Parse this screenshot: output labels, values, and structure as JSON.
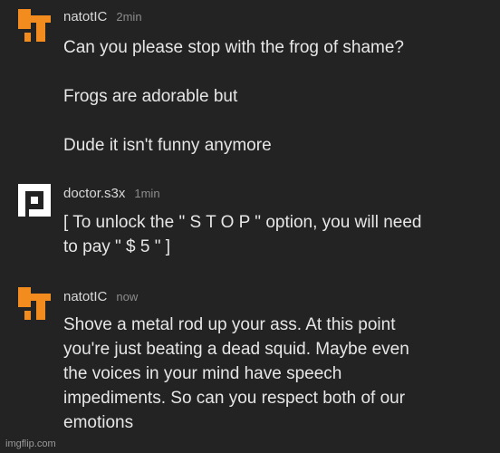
{
  "comments": [
    {
      "avatar_icon": "orange-blocky-avatar-icon",
      "avatar_color": "#F28C1E",
      "username": "natotIC",
      "time": "2min",
      "lines": [
        "Can you please stop with the frog of shame?",
        "",
        "Frogs are adorable but",
        "",
        "Dude it isn't funny anymore"
      ]
    },
    {
      "avatar_icon": "white-p-avatar-icon",
      "avatar_color": "#FFFFFF",
      "username": "doctor.s3x",
      "time": "1min",
      "lines": [
        "[ To unlock the \" S T O P \" option, you will need",
        "to pay \" $ 5 \" ]"
      ]
    },
    {
      "avatar_icon": "orange-blocky-avatar-icon",
      "avatar_color": "#F28C1E",
      "username": "natotIC",
      "time": "now",
      "lines": [
        "Shove a metal rod up your ass. At this point",
        "you're just beating a dead squid. Maybe even",
        "the voices in your mind have speech",
        "impediments. So can you respect both of our",
        "emotions"
      ]
    }
  ],
  "watermark": "imgflip.com"
}
